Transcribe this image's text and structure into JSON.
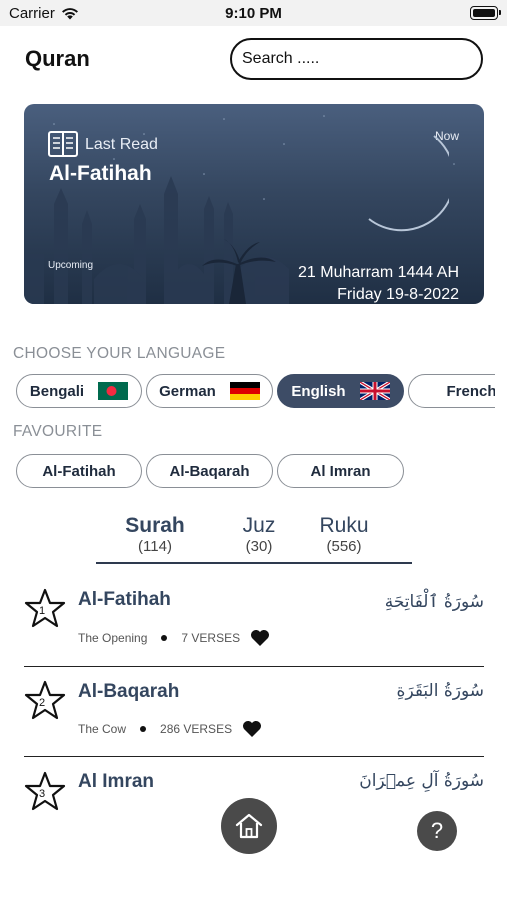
{
  "status": {
    "carrier": "Carrier",
    "time": "9:10 PM"
  },
  "header": {
    "title": "Quran",
    "search_placeholder": "Search ....."
  },
  "banner": {
    "last_read_label": "Last Read",
    "surah": "Al-Fatihah",
    "now_label": "Now",
    "upcoming_label": "Upcoming",
    "hijri_date": "21 Muharram 1444 AH",
    "gregorian_date": "Friday 19-8-2022"
  },
  "language_section": {
    "label": "CHOOSE YOUR LANGUAGE",
    "options": [
      {
        "label": "Bengali",
        "flag": "bangladesh-flag",
        "active": false
      },
      {
        "label": "German",
        "flag": "germany-flag",
        "active": false
      },
      {
        "label": "English",
        "flag": "uk-flag",
        "active": true
      },
      {
        "label": "French",
        "flag": "france-flag",
        "active": false
      }
    ]
  },
  "favourite_section": {
    "label": "FAVOURITE",
    "items": [
      "Al-Fatihah",
      "Al-Baqarah",
      "Al Imran"
    ]
  },
  "tabs": [
    {
      "name": "Surah",
      "count": "(114)",
      "active": true
    },
    {
      "name": "Juz",
      "count": "(30)",
      "active": false
    },
    {
      "name": "Ruku",
      "count": "(556)",
      "active": false
    }
  ],
  "surahs": [
    {
      "number": "1",
      "name": "Al-Fatihah",
      "meaning": "The Opening",
      "verses": "7 VERSES",
      "arabic": "سُورَةُ ٱلْفَاتِحَةِ"
    },
    {
      "number": "2",
      "name": "Al-Baqarah",
      "meaning": "The Cow",
      "verses": "286 VERSES",
      "arabic": "سُورَةُ البَقَرَةِ"
    },
    {
      "number": "3",
      "name": "Al Imran",
      "meaning": "",
      "verses": "",
      "arabic": "سُورَةُ آلِ عِمۡرَانَ"
    }
  ],
  "bottom": {
    "help_label": "?"
  },
  "colors": {
    "accent": "#3d4c66",
    "banner_dark": "#1f2f44",
    "muted": "#8a8f96"
  }
}
